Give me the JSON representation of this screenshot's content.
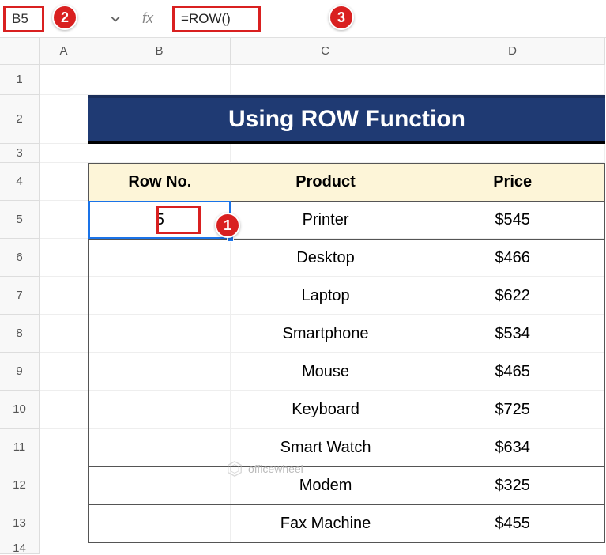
{
  "formula_bar": {
    "name_box": "B5",
    "fx_label": "fx",
    "formula": "=ROW()"
  },
  "callouts": {
    "c1": "1",
    "c2": "2",
    "c3": "3"
  },
  "columns": {
    "A": "A",
    "B": "B",
    "C": "C",
    "D": "D"
  },
  "rows": {
    "r1": "1",
    "r2": "2",
    "r3": "3",
    "r4": "4",
    "r5": "5",
    "r6": "6",
    "r7": "7",
    "r8": "8",
    "r9": "9",
    "r10": "10",
    "r11": "11",
    "r12": "12",
    "r13": "13",
    "r14": "14"
  },
  "title": "Using ROW Function",
  "headers": {
    "rowno": "Row No.",
    "product": "Product",
    "price": "Price"
  },
  "table": [
    {
      "rowno": "5",
      "product": "Printer",
      "price": "$545"
    },
    {
      "rowno": "",
      "product": "Desktop",
      "price": "$466"
    },
    {
      "rowno": "",
      "product": "Laptop",
      "price": "$622"
    },
    {
      "rowno": "",
      "product": "Smartphone",
      "price": "$534"
    },
    {
      "rowno": "",
      "product": "Mouse",
      "price": "$465"
    },
    {
      "rowno": "",
      "product": "Keyboard",
      "price": "$725"
    },
    {
      "rowno": "",
      "product": "Smart Watch",
      "price": "$634"
    },
    {
      "rowno": "",
      "product": "Modem",
      "price": "$325"
    },
    {
      "rowno": "",
      "product": "Fax Machine",
      "price": "$455"
    }
  ],
  "watermark": "officewheel"
}
